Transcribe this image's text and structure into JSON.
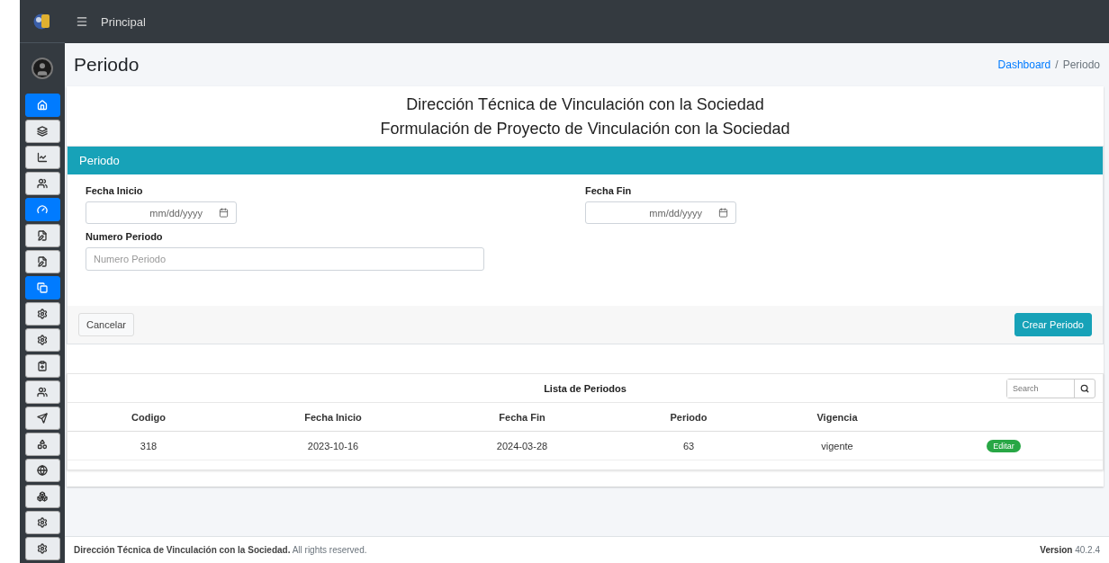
{
  "topbar": {
    "title": "Principal"
  },
  "sidebar": {
    "items": [
      {
        "selected": true
      },
      {
        "selected": false
      },
      {
        "selected": false
      },
      {
        "selected": false
      },
      {
        "selected": true
      },
      {
        "selected": false
      },
      {
        "selected": false
      },
      {
        "selected": true
      },
      {
        "selected": false
      },
      {
        "selected": false
      },
      {
        "selected": false
      },
      {
        "selected": false
      },
      {
        "selected": false
      },
      {
        "selected": false
      },
      {
        "selected": false
      },
      {
        "selected": false
      },
      {
        "selected": false
      },
      {
        "selected": false
      }
    ]
  },
  "page_header": {
    "title": "Periodo",
    "breadcrumb_separator": "/",
    "breadcrumb": [
      {
        "label": "Dashboard",
        "link": true
      },
      {
        "label": "Periodo",
        "link": false
      }
    ]
  },
  "headings": [
    "Dirección Técnica de Vinculación con la Sociedad",
    "Formulación de Proyecto de Vinculación con la Sociedad"
  ],
  "form": {
    "title": "Periodo",
    "fecha_inicio": {
      "label": "Fecha Inicio",
      "placeholder": "mm/dd/yyyy"
    },
    "fecha_fin": {
      "label": "Fecha Fin",
      "placeholder": "mm/dd/yyyy"
    },
    "numero_periodo": {
      "label": "Numero Periodo",
      "placeholder": "Numero Periodo"
    },
    "cancel_button": "Cancelar",
    "submit_button": "Crear Periodo"
  },
  "table": {
    "title": "Lista de Periodos",
    "search": {
      "placeholder": "Search"
    },
    "columns": [
      "Codigo",
      "Fecha Inicio",
      "Fecha Fin",
      "Periodo",
      "Vigencia"
    ],
    "rows": [
      {
        "cells": [
          "318",
          "2023-10-16",
          "2024-03-28",
          "63",
          "vigente"
        ],
        "action": "Editar"
      }
    ]
  },
  "footer": {
    "text": "**Dirección Técnica de Vinculación con la Sociedad.** All rights reserved.",
    "version_label": "Version",
    "version": "40.2.4"
  }
}
